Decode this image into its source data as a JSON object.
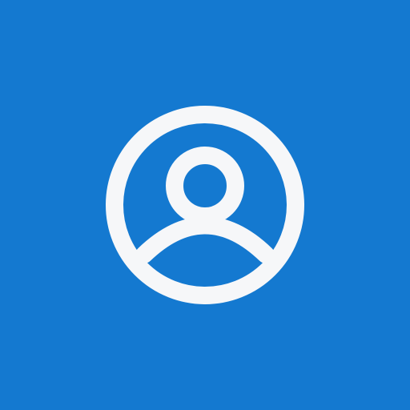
{
  "avatar": {
    "icon": "user-circle-icon",
    "background_color": "#1479d0",
    "icon_color": "#f6f7f9"
  }
}
